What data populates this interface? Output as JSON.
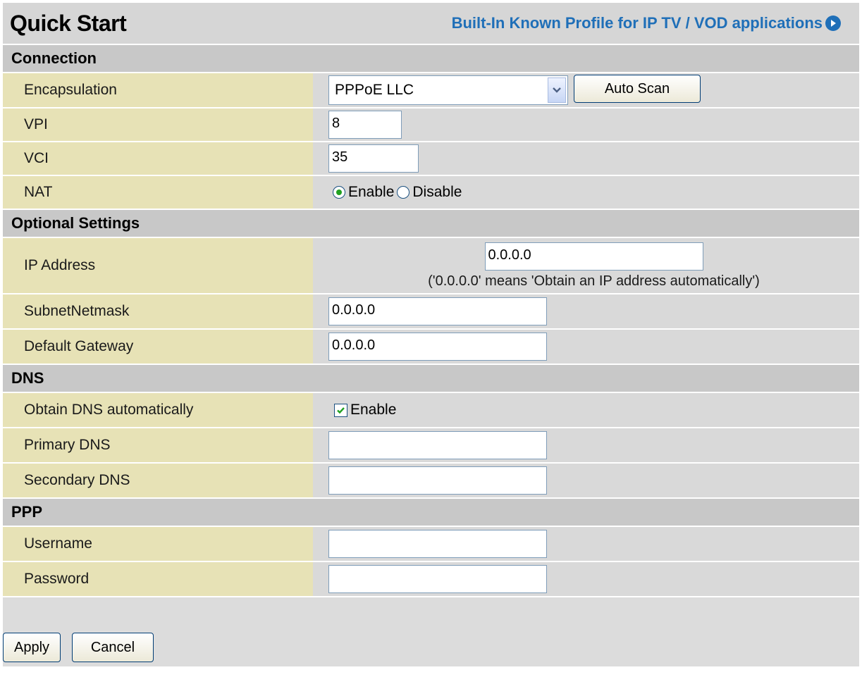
{
  "header": {
    "title": "Quick Start",
    "profile_link": "Built-In Known Profile for IP TV / VOD applications"
  },
  "connection": {
    "section_title": "Connection",
    "encapsulation": {
      "label": "Encapsulation",
      "value": "PPPoE LLC",
      "scan_button": "Auto Scan"
    },
    "vpi": {
      "label": "VPI",
      "value": "8"
    },
    "vci": {
      "label": "VCI",
      "value": "35"
    },
    "nat": {
      "label": "NAT",
      "options": [
        "Enable",
        "Disable"
      ],
      "selected": "Enable"
    }
  },
  "optional": {
    "section_title": "Optional Settings",
    "ip_address": {
      "label": "IP Address",
      "value": "0.0.0.0",
      "hint": "('0.0.0.0' means 'Obtain an IP address automatically')"
    },
    "subnet": {
      "label": "SubnetNetmask",
      "value": "0.0.0.0"
    },
    "gateway": {
      "label": "Default Gateway",
      "value": "0.0.0.0"
    }
  },
  "dns": {
    "section_title": "DNS",
    "obtain": {
      "label": "Obtain DNS automatically",
      "checkbox_label": "Enable",
      "checked": true
    },
    "primary": {
      "label": "Primary DNS",
      "value": ""
    },
    "secondary": {
      "label": "Secondary DNS",
      "value": ""
    }
  },
  "ppp": {
    "section_title": "PPP",
    "username": {
      "label": "Username",
      "value": ""
    },
    "password": {
      "label": "Password",
      "value": ""
    }
  },
  "actions": {
    "apply": "Apply",
    "cancel": "Cancel"
  },
  "colors": {
    "link": "#1f6fb8",
    "label_bg": "#e7e2b6",
    "section_bg": "#c8c8c8",
    "value_bg": "#d9d9d9"
  },
  "icons": {
    "profile_link": "arrow-circle-icon",
    "select": "chevron-down-icon",
    "check": "checkmark-icon"
  }
}
